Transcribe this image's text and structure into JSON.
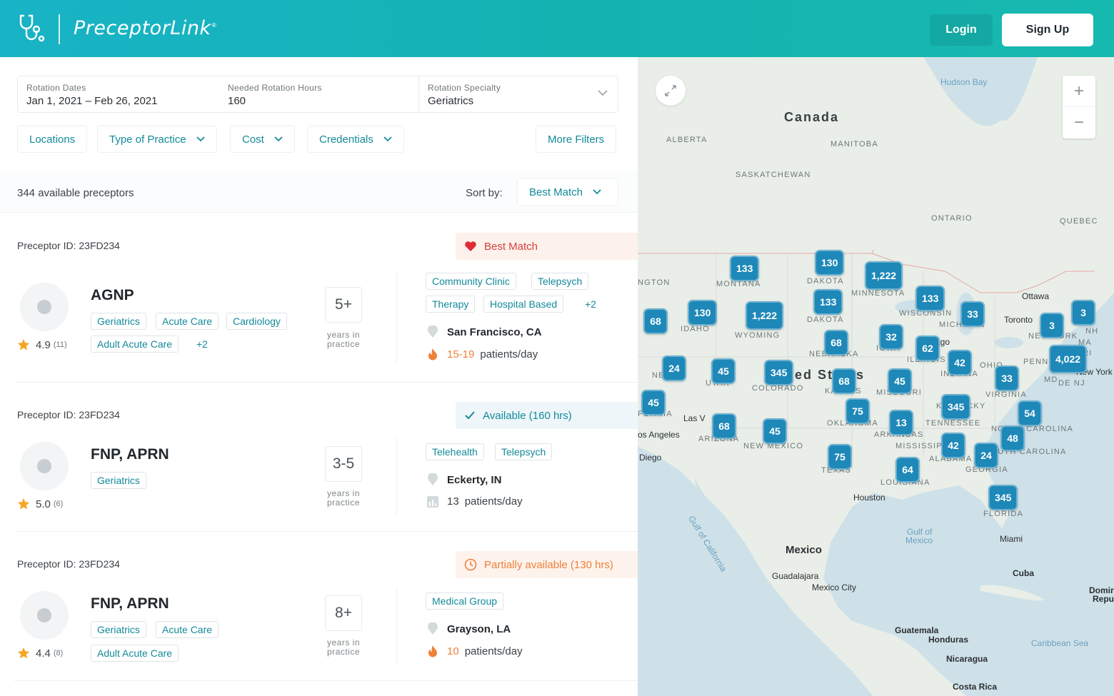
{
  "header": {
    "brand": "PreceptorLink",
    "trademark": "®",
    "login_label": "Login",
    "signup_label": "Sign Up",
    "gradient": [
      "#18b3c6",
      "#16b9b0"
    ]
  },
  "search": {
    "dates_label": "Rotation Dates",
    "dates_value": "Jan 1, 2021 – Feb 26, 2021",
    "hours_label": "Needed Rotation Hours",
    "hours_value": "160",
    "specialty_label": "Rotation Specialty",
    "specialty_value": "Geriatrics"
  },
  "filters": {
    "locations": "Locations",
    "practice_type": "Type of Practice",
    "cost": "Cost",
    "credentials": "Credentials",
    "more": "More Filters"
  },
  "results": {
    "count_text": "344 available preceptors",
    "sort_label": "Sort by:",
    "sort_value": "Best Match"
  },
  "cards": [
    {
      "preceptor_id": "Preceptor ID: 23FD234",
      "status": "Best Match",
      "status_icon": "heart-icon",
      "role": "AGNP",
      "rating": "4.9",
      "reviews": "(11)",
      "tags": [
        "Geriatrics",
        "Acute Care",
        "Cardiology",
        "Adult Acute Care",
        "+2"
      ],
      "years": "5+",
      "years_label": "years in practice",
      "practice_types": [
        "Community Clinic",
        "Telepsych",
        "Therapy",
        "Hospital Based",
        "+2"
      ],
      "location": "San Francisco, CA",
      "patients_num": "15-19",
      "patients_unit": "patients/day",
      "patients_icon": "flame-icon"
    },
    {
      "preceptor_id": "Preceptor ID: 23FD234",
      "status": "Available (160 hrs)",
      "status_icon": "check-icon",
      "role": "FNP, APRN",
      "rating": "5.0",
      "reviews": "(6)",
      "tags": [
        "Geriatrics"
      ],
      "years": "3-5",
      "years_label": "years in practice",
      "practice_types": [
        "Telehealth",
        "Telepsych"
      ],
      "location": "Eckerty, IN",
      "patients_num": "13",
      "patients_unit": "patients/day",
      "patients_icon": "bar-chart-icon"
    },
    {
      "preceptor_id": "Preceptor ID: 23FD234",
      "status": "Partially available (130 hrs)",
      "status_icon": "clock-icon",
      "role": "FNP, APRN",
      "rating": "4.4",
      "reviews": "(8)",
      "tags": [
        "Geriatrics",
        "Acute Care",
        "Adult Acute Care"
      ],
      "years": "8+",
      "years_label": "years in practice",
      "practice_types": [
        "Medical Group"
      ],
      "location": "Grayson, LA",
      "patients_num": "10",
      "patients_unit": "patients/day",
      "patients_icon": "flame-icon"
    }
  ],
  "map": {
    "labels": {
      "hudson_bay": "Hudson Bay",
      "canada": "Canada",
      "alberta": "ALBERTA",
      "manitoba": "MANITOBA",
      "saskatchewan": "SASKATCHEWAN",
      "ontario": "ONTARIO",
      "quebec": "QUEBEC",
      "ottawa": "Ottawa",
      "toronto": "Toronto",
      "new_york_state": "NEW YORK",
      "new_york_city": "New York",
      "nh": "NH",
      "ma": "MA",
      "ri": "T RI",
      "penn": "PENN",
      "md": "MD",
      "de_nj": "DE NJ",
      "ohio": "OHIO",
      "virginia": "VIRGINIA",
      "ington": "NGTON",
      "montana": "MONTANA",
      "n_dakota": "DAKOTA",
      "minnesota": "MINNESOTA",
      "s_dakota": "DAKOTA",
      "wisconsin": "WISCONSIN",
      "michigan": "MICHIGAN",
      "idaho": "IDAHO",
      "wyoming": "WYOMING",
      "nebraska": "NEBRASKA",
      "iowa": "IOWA",
      "illinois": "ILLINOIS",
      "chicago": "cago",
      "indiana": "INDIANA",
      "nevada": "NE",
      "utah": "UTAH",
      "us": "United States",
      "colorado": "COLORADO",
      "kansas": "KANSAS",
      "missouri": "MISSOURI",
      "kentucky": "KENTUCKY",
      "california": "FORNIA",
      "las_vegas": "Las V",
      "los_angeles": "os Angeles",
      "san_diego": "Diego",
      "arizona": "ARIZONA",
      "new_mexico": "NEW MEXICO",
      "oklahoma": "OKLAHOMA",
      "arkansas": "ARKANSAS",
      "tennessee": "TENNESSEE",
      "n_carolina": "NORTH CAROLINA",
      "s_carolina": "SOUTH CAROLINA",
      "mississippi": "MISSISSIPPI",
      "alabama": "ALABAMA",
      "georgia": "GEORGIA",
      "texas": "TEXAS",
      "louisiana": "LOUISIANA",
      "houston": "Houston",
      "florida": "FLORIDA",
      "miami": "Miami",
      "gulf_california": "Gulf of California",
      "gulf_mexico_1": "Gulf of",
      "gulf_mexico_2": "Mexico",
      "mexico": "Mexico",
      "guadalajara": "Guadalajara",
      "mexico_city": "Mexico City",
      "cuba": "Cuba",
      "dominican_1": "Domir",
      "dominican_2": "Repu",
      "guatemala": "Guatemala",
      "honduras": "Honduras",
      "caribbean": "Caribbean Sea",
      "nicaragua": "Nicaragua",
      "costa_rica": "Costa Rica"
    },
    "clusters": [
      "133",
      "130",
      "1,222",
      "133",
      "68",
      "130",
      "1,222",
      "133",
      "33",
      "3",
      "3",
      "68",
      "32",
      "62",
      "42",
      "4,022",
      "24",
      "45",
      "345",
      "68",
      "45",
      "33",
      "45",
      "75",
      "13",
      "345",
      "54",
      "68",
      "45",
      "48",
      "42",
      "24",
      "75",
      "64",
      "345"
    ],
    "zoom_in": "+",
    "zoom_out": "−"
  }
}
